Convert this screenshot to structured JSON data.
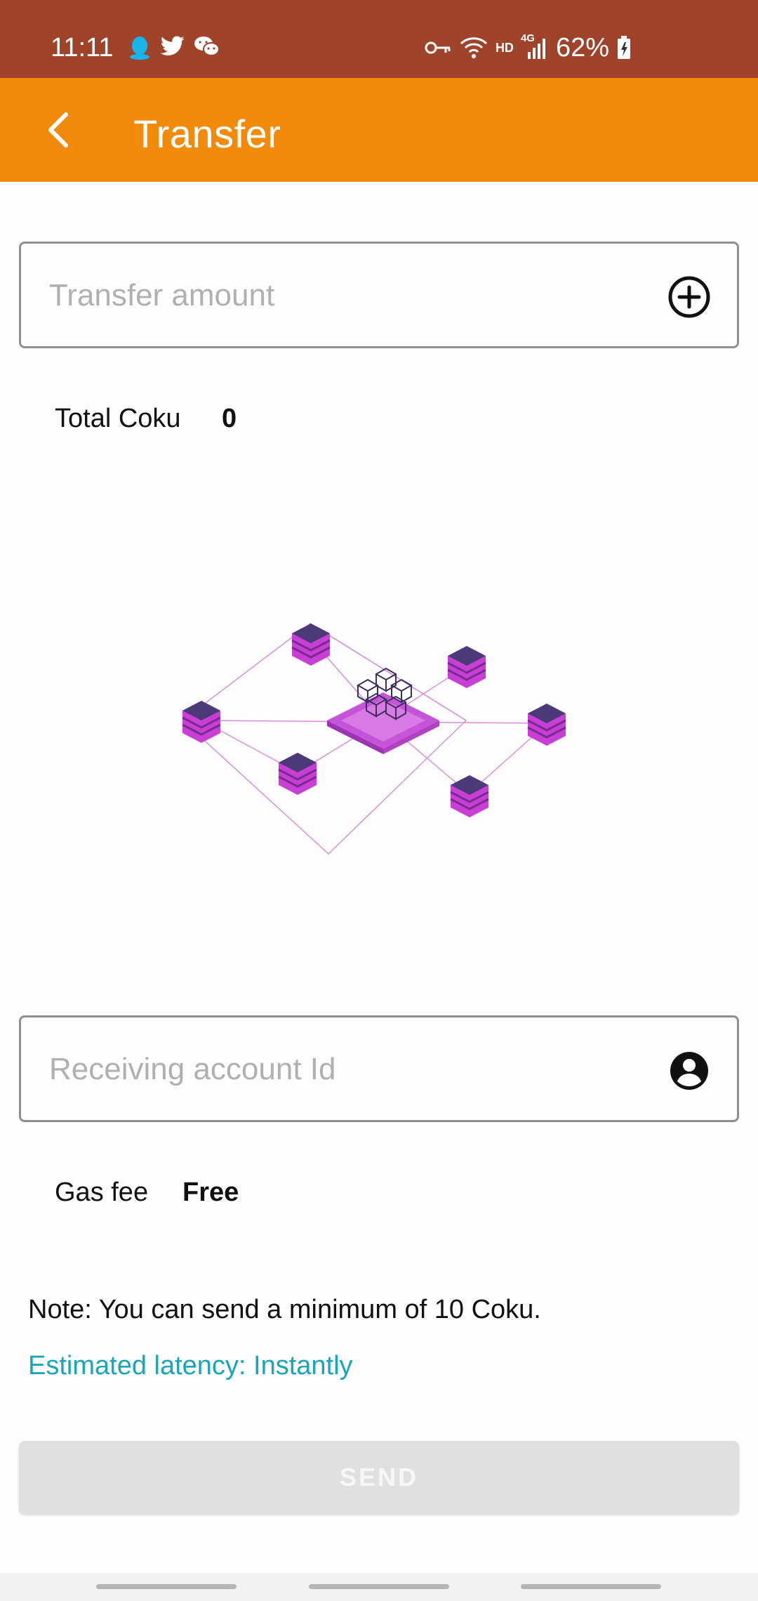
{
  "status_bar": {
    "time": "11:11",
    "battery": "62%",
    "network": "4G",
    "hd": "HD",
    "icons": [
      "qq-icon",
      "twitter-icon",
      "wechat-icon",
      "key-icon",
      "wifi-icon",
      "signal-icon",
      "battery-icon"
    ]
  },
  "app_bar": {
    "title": "Transfer",
    "background": "#f28b0c"
  },
  "amount_field": {
    "placeholder": "Transfer amount",
    "icon": "add-circle-icon"
  },
  "total": {
    "label": "Total Coku",
    "value": "0"
  },
  "account_field": {
    "placeholder": "Receiving account Id",
    "icon": "account-circle-icon"
  },
  "gas_fee": {
    "label": "Gas fee",
    "value": "Free"
  },
  "note": "Note: You can send a minimum of 10 Coku.",
  "latency": "Estimated latency: Instantly",
  "send_button": {
    "label": "SEND",
    "enabled": false
  },
  "colors": {
    "status_bar": "#a0432b",
    "accent": "#f28b0c",
    "latency_text": "#1aa6b6",
    "illustration_primary": "#c93fd6",
    "illustration_dark": "#4a3a78"
  }
}
